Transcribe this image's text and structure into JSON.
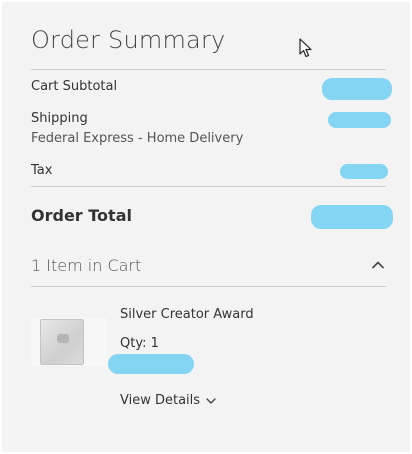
{
  "summary": {
    "title": "Order Summary",
    "rows": {
      "subtotal_label": "Cart Subtotal",
      "shipping_label": "Shipping",
      "shipping_method": "Federal Express - Home Delivery",
      "tax_label": "Tax"
    },
    "total_label": "Order Total"
  },
  "cart": {
    "count_label": "1 Item in Cart",
    "toggle_icon": "chevron-up-icon",
    "item": {
      "name": "Silver Creator Award",
      "qty_label": "Qty: 1",
      "details_label": "View Details",
      "details_icon": "chevron-down-icon"
    }
  },
  "colors": {
    "panel_background": "#f3f3f3",
    "redaction": "#7dd3f3",
    "divider": "#cfcfcf"
  }
}
